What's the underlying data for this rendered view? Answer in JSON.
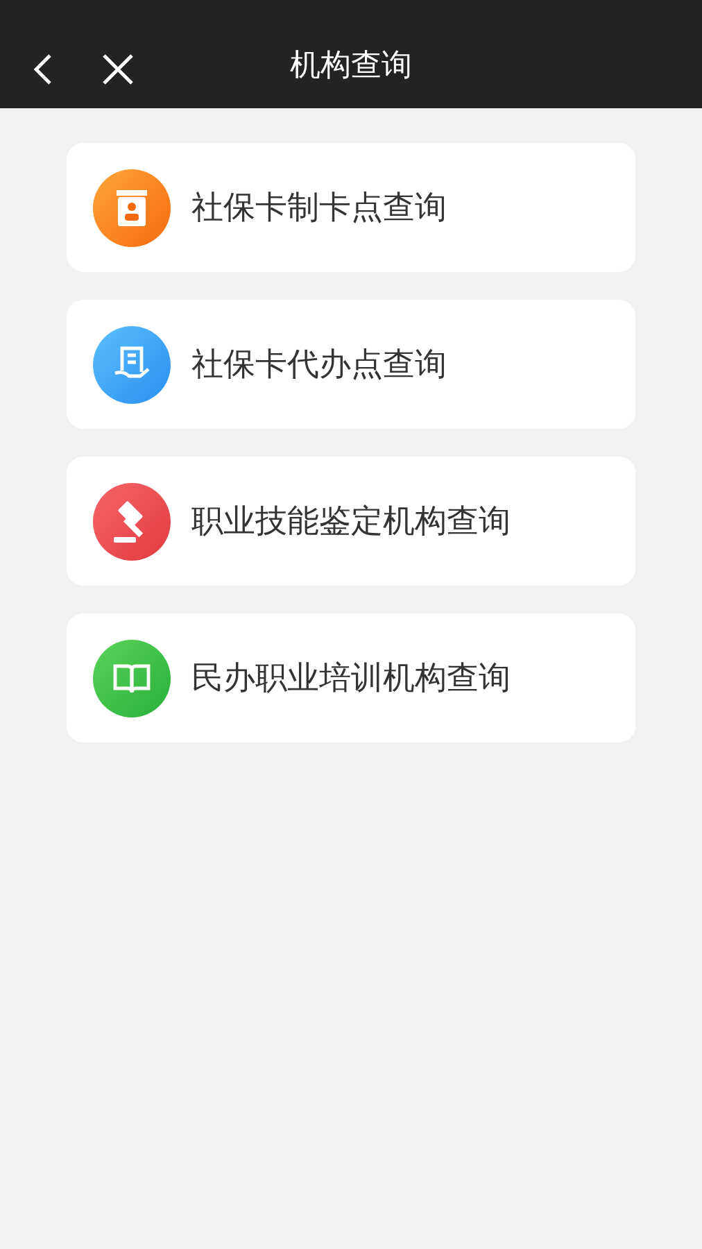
{
  "header": {
    "title": "机构查询"
  },
  "items": [
    {
      "kind": "card",
      "label": "社保卡制卡点查询"
    },
    {
      "kind": "handout",
      "label": "社保卡代办点查询"
    },
    {
      "kind": "gavel",
      "label": "职业技能鉴定机构查询"
    },
    {
      "kind": "book",
      "label": "民办职业培训机构查询"
    }
  ]
}
